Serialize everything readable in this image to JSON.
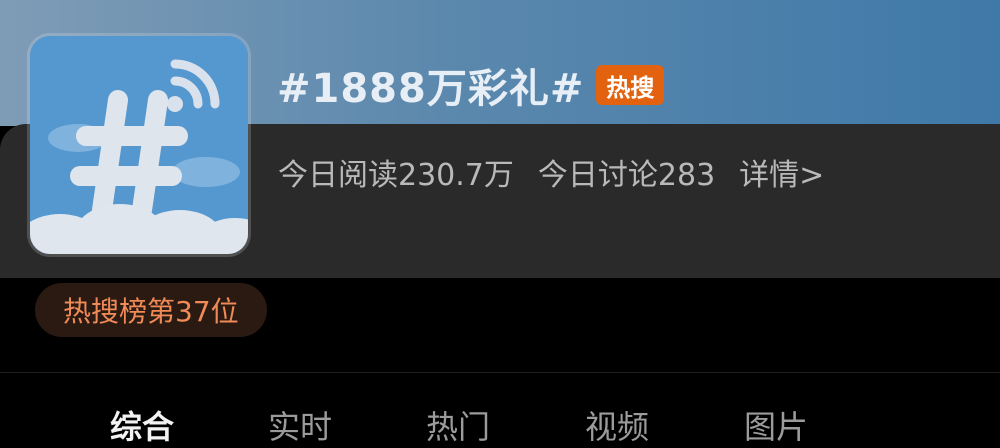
{
  "topic": {
    "title": "#1888万彩礼#",
    "badge": "热搜",
    "avatar_icon": "hashtag-signal-icon",
    "stats": {
      "reads": "今日阅读230.7万",
      "discussions": "今日讨论283",
      "details_link": "详情>"
    },
    "rank": "热搜榜第37位"
  },
  "tabs": [
    {
      "label": "综合",
      "active": true
    },
    {
      "label": "实时",
      "active": false
    },
    {
      "label": "热门",
      "active": false
    },
    {
      "label": "视频",
      "active": false
    },
    {
      "label": "图片",
      "active": false
    }
  ],
  "colors": {
    "badge_bg": "#e2620f",
    "rank_text": "#f08a57",
    "header_gradient_start": "#7f9cb6",
    "header_gradient_end": "#3f79a8"
  }
}
